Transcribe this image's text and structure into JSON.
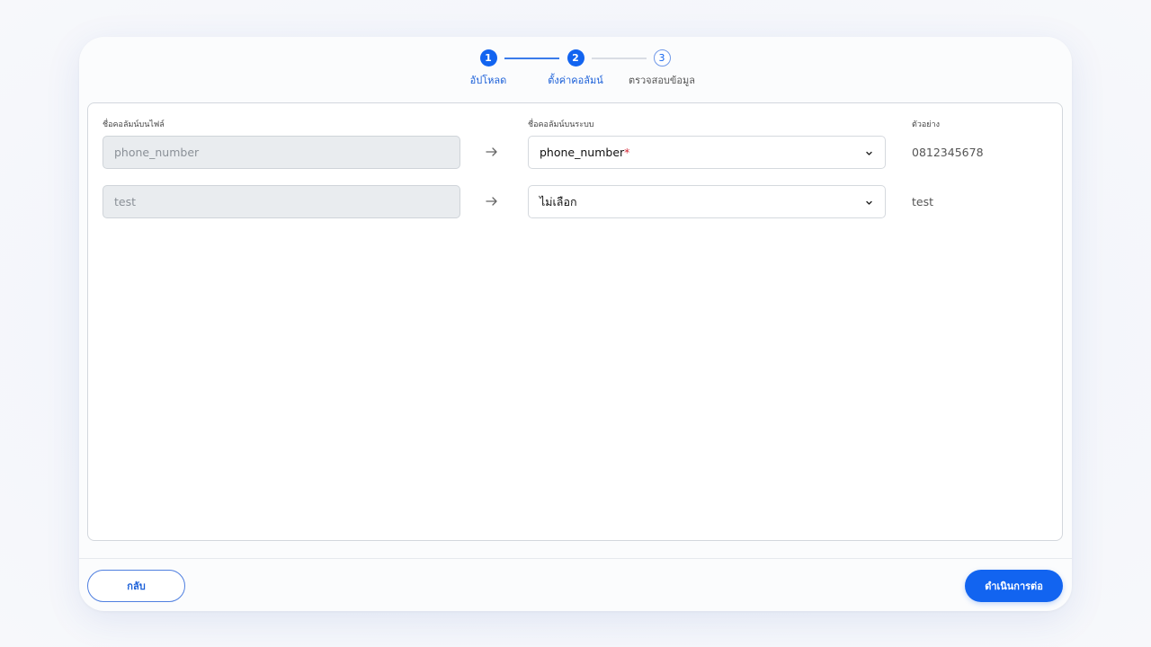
{
  "stepper": {
    "steps": [
      {
        "number": "1",
        "label": "อัปโหลด",
        "state": "done"
      },
      {
        "number": "2",
        "label": "ตั้งค่าคอลัมน์",
        "state": "current"
      },
      {
        "number": "3",
        "label": "ตรวจสอบข้อมูล",
        "state": "todo"
      }
    ]
  },
  "mapping": {
    "headers": {
      "file_column": "ชื่อคอลัมน์บนไฟล์",
      "system_column": "ชื่อคอลัมน์บนระบบ",
      "sample": "ตัวอย่าง"
    },
    "rows": [
      {
        "file_column": "phone_number",
        "system_column": "phone_number",
        "required_mark": "*",
        "sample": "0812345678"
      },
      {
        "file_column": "test",
        "system_column": "ไม่เลือก",
        "required_mark": "",
        "sample": "test"
      }
    ]
  },
  "footer": {
    "back_label": "กลับ",
    "next_label": "ดำเนินการต่อ"
  },
  "colors": {
    "primary": "#1264f0",
    "required": "#d62b3a"
  },
  "icons": [
    "arrow-right-icon",
    "chevron-down-icon"
  ]
}
